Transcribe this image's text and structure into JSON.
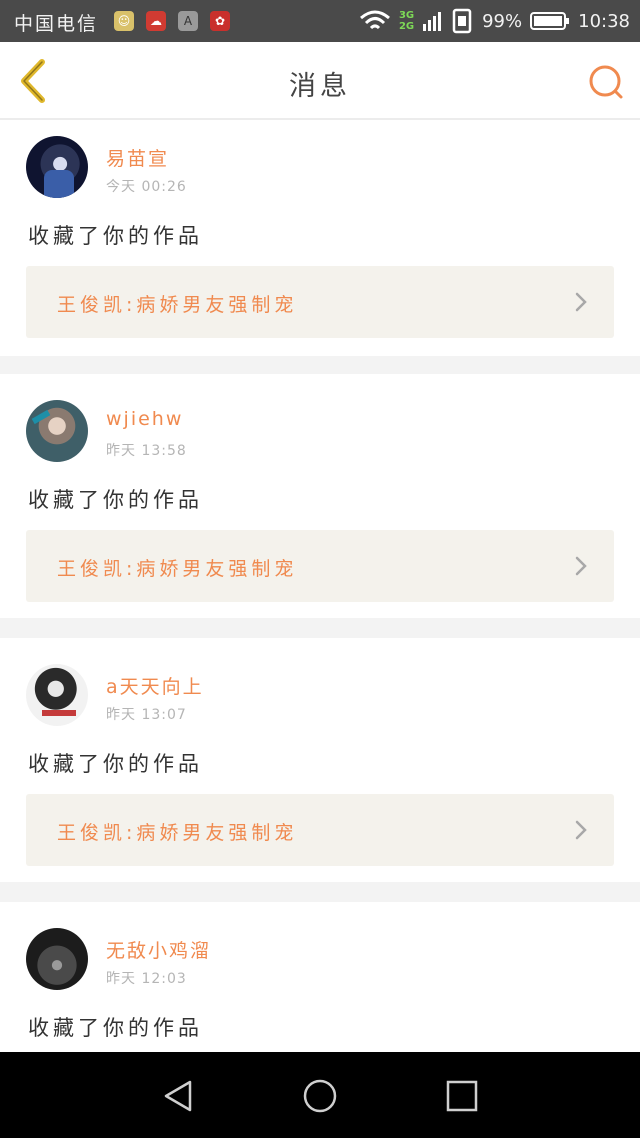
{
  "status_bar": {
    "carrier": "中国电信",
    "apps": [
      "wechat-icon",
      "cloud-app-icon",
      "a-app-icon",
      "huawei-icon"
    ],
    "app_a_label": "A",
    "net_top": "3G",
    "net_bottom": "2G",
    "battery": "99%",
    "time": "10:38"
  },
  "header": {
    "title": "消息"
  },
  "messages": [
    {
      "username": "易苗宣",
      "time": "今天 00:26",
      "action": "收藏了你的作品",
      "work_title": "王俊凯:病娇男友强制宠"
    },
    {
      "username": "wjiehw",
      "time": "昨天 13:58",
      "action": "收藏了你的作品",
      "work_title": "王俊凯:病娇男友强制宠"
    },
    {
      "username": "a天天向上",
      "time": "昨天 13:07",
      "action": "收藏了你的作品",
      "work_title": "王俊凯:病娇男友强制宠"
    },
    {
      "username": "无敌小鸡溜",
      "time": "昨天 12:03",
      "action": "收藏了你的作品"
    }
  ],
  "colors": {
    "accent": "#f08a4f",
    "back_arrow": "#e0b82c",
    "work_bg": "#f4f2ec",
    "status_bar": "#4a4a4a"
  }
}
